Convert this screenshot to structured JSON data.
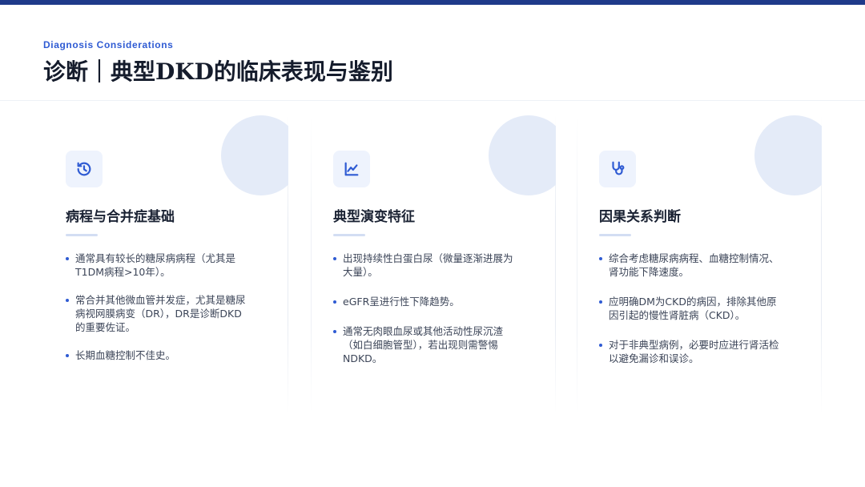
{
  "header": {
    "subtitle": "Diagnosis Considerations",
    "title": "诊断｜典型DKD的临床表现与鉴别"
  },
  "colors": {
    "accent": "#2f5bd3",
    "top_bar": "#1f3a8a",
    "deco_circle": "#e4ebf8"
  },
  "cards": [
    {
      "icon": "history-icon",
      "title": "病程与合并症基础",
      "bullets": [
        "通常具有较长的糖尿病病程（尤其是T1DM病程>10年）。",
        "常合并其他微血管并发症，尤其是糖尿病视网膜病变（DR），DR是诊断DKD的重要佐证。",
        "长期血糖控制不佳史。"
      ]
    },
    {
      "icon": "line-chart-icon",
      "title": "典型演变特征",
      "bullets": [
        "出现持续性白蛋白尿（微量逐渐进展为大量）。",
        "eGFR呈进行性下降趋势。",
        "通常无肉眼血尿或其他活动性尿沉渣（如白细胞管型），若出现则需警惕NDKD。"
      ]
    },
    {
      "icon": "stethoscope-icon",
      "title": "因果关系判断",
      "bullets": [
        "综合考虑糖尿病病程、血糖控制情况、肾功能下降速度。",
        "应明确DM为CKD的病因，排除其他原因引起的慢性肾脏病（CKD）。",
        "对于非典型病例，必要时应进行肾活检以避免漏诊和误诊。"
      ]
    }
  ]
}
